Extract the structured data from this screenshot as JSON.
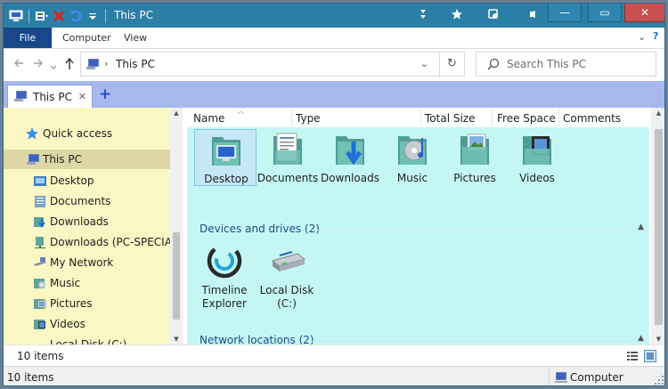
{
  "window": {
    "title": "This PC",
    "controls": {
      "minimize": "—",
      "maximize": "▭",
      "close": "✕"
    }
  },
  "ribbon": {
    "tabs": [
      "File",
      "Computer",
      "View"
    ],
    "collapse": "⌄",
    "help": "?"
  },
  "address": {
    "location": "This PC",
    "refresh": "↻"
  },
  "search": {
    "placeholder": "Search This PC"
  },
  "tab": {
    "label": "This PC",
    "close": "✕",
    "new": "+"
  },
  "nav_pane": {
    "items": [
      {
        "label": "Quick access",
        "icon": "star-icon"
      },
      {
        "label": "This PC",
        "icon": "computer-icon",
        "selected": true
      },
      {
        "label": "Desktop",
        "icon": "desktop-folder-icon"
      },
      {
        "label": "Documents",
        "icon": "documents-folder-icon"
      },
      {
        "label": "Downloads",
        "icon": "downloads-folder-icon"
      },
      {
        "label": "Downloads (PC-SPECIAL)",
        "icon": "network-drive-icon"
      },
      {
        "label": "My Network",
        "icon": "network-icon"
      },
      {
        "label": "Music",
        "icon": "music-folder-icon"
      },
      {
        "label": "Pictures",
        "icon": "pictures-folder-icon"
      },
      {
        "label": "Videos",
        "icon": "videos-folder-icon"
      },
      {
        "label": "Local Disk (C:)",
        "icon": "local-disk-icon"
      }
    ]
  },
  "columns": [
    "Name",
    "Type",
    "Total Size",
    "Free Space",
    "Comments"
  ],
  "folders": [
    {
      "label": "Desktop",
      "selected": true
    },
    {
      "label": "Documents"
    },
    {
      "label": "Downloads"
    },
    {
      "label": "Music"
    },
    {
      "label": "Pictures"
    },
    {
      "label": "Videos"
    }
  ],
  "groups": {
    "devices": "Devices and drives (2)",
    "network": "Network locations (2)"
  },
  "drives": [
    {
      "line1": "Timeline",
      "line2": "Explorer"
    },
    {
      "line1": "Local Disk",
      "line2": "(C:)"
    }
  ],
  "status": {
    "item_count": "10 items",
    "item_count_bottom": "10 items",
    "computer": "Computer"
  },
  "colors": {
    "titlebar": "#2b7fa6",
    "file_tab": "#19478a",
    "tabbar": "#a6b8ee",
    "nav_bg": "#fbf7c4",
    "content_bg": "#c4f7f4"
  }
}
